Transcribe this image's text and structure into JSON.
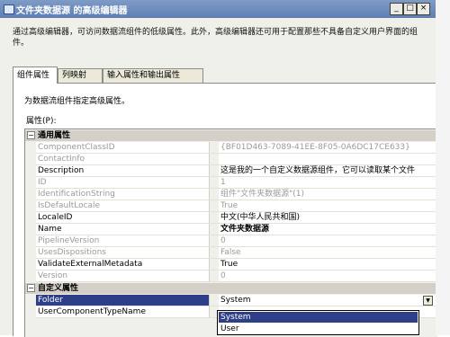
{
  "window": {
    "title": "文件夹数据源 的高级编辑器",
    "minimize": "_",
    "maximize": "□",
    "close": "×"
  },
  "intro": "通过高级编辑器，可访问数据流组件的低级属性。此外，高级编辑器还可用于配置那些不具备自定义用户界面的组件。",
  "tabs": [
    "组件属性",
    "列映射",
    "输入属性和输出属性"
  ],
  "panel": {
    "description": "为数据流组件指定高级属性。",
    "properties_label": "属性(P):"
  },
  "categories": [
    {
      "toggle": "⊟",
      "name": "通用属性",
      "rows": [
        {
          "name": "ComponentClassID",
          "value": "{BF01D463-7089-41EE-8F05-0A6DC17CE633}"
        },
        {
          "name": "ContactInfo",
          "value": ""
        },
        {
          "name": "Description",
          "value": "这是我的一个自定义数据源组件，它可以读取某个文件"
        },
        {
          "name": "ID",
          "value": "1"
        },
        {
          "name": "IdentificationString",
          "value": "组件\"文件夹数据源\"(1)"
        },
        {
          "name": "IsDefaultLocale",
          "value": "True"
        },
        {
          "name": "LocaleID",
          "value": "中文(中华人民共和国)"
        },
        {
          "name": "Name",
          "value": "文件夹数据源"
        },
        {
          "name": "PipelineVersion",
          "value": "0"
        },
        {
          "name": "UsesDispositions",
          "value": "False"
        },
        {
          "name": "ValidateExternalMetadata",
          "value": "True"
        },
        {
          "name": "Version",
          "value": "0"
        }
      ]
    },
    {
      "toggle": "⊟",
      "name": "自定义属性",
      "rows": [
        {
          "name": "Folder",
          "value": "System"
        },
        {
          "name": "UserComponentTypeName",
          "value": ""
        }
      ]
    }
  ],
  "dropdown": {
    "arrow": "▼",
    "options": [
      "System",
      "User"
    ],
    "highlighted": "System"
  },
  "colors": {
    "titlebar": "#6b89bd",
    "selection": "#2f3f87",
    "readonly_text": "#9a9a9a"
  }
}
